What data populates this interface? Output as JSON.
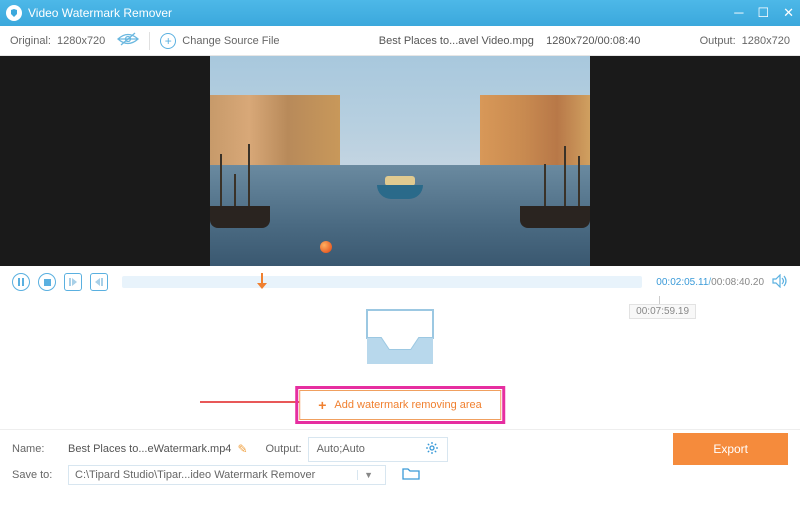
{
  "titlebar": {
    "title": "Video Watermark Remover"
  },
  "toolbar": {
    "original_label": "Original:",
    "original_res": "1280x720",
    "change_source": "Change Source File",
    "filename": "Best Places to...avel Video.mpg",
    "file_res": "1280x720",
    "file_dur": "00:08:40",
    "output_label": "Output:",
    "output_res": "1280x720"
  },
  "transport": {
    "current": "00:02:05.11",
    "total": "00:08:40.20",
    "marker": "00:07:59.19"
  },
  "add_button": {
    "label": "Add watermark removing area"
  },
  "bottom": {
    "name_label": "Name:",
    "name_value": "Best Places to...eWatermark.mp4",
    "output_label": "Output:",
    "output_value": "Auto;Auto",
    "saveto_label": "Save to:",
    "saveto_value": "C:\\Tipard Studio\\Tipar...ideo Watermark Remover",
    "export": "Export"
  }
}
